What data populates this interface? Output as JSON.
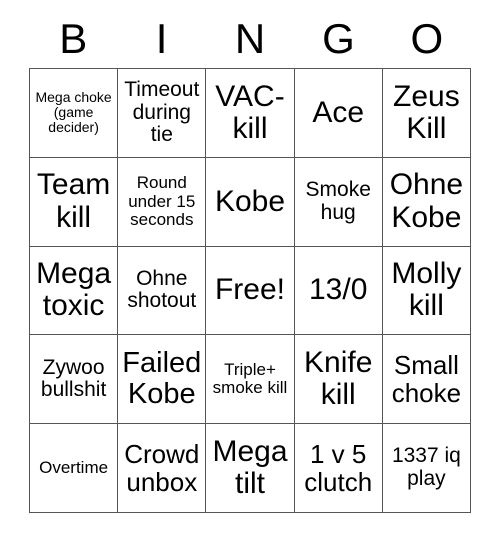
{
  "card": {
    "title": "BINGO",
    "header_letters": [
      "B",
      "I",
      "N",
      "G",
      "O"
    ],
    "rows": 5,
    "columns": 5,
    "grid_line_color": "#555555",
    "background_color": "#ffffff",
    "text_color": "#000000",
    "free_space": "Free!",
    "free_space_position": {
      "row": 3,
      "column": 3
    }
  },
  "cells": [
    {
      "id": "b1",
      "column": "B",
      "row": 1,
      "text": "Mega choke (game decider)",
      "size": "xs"
    },
    {
      "id": "i1",
      "column": "I",
      "row": 1,
      "text": "Timeout during tie",
      "size": "md"
    },
    {
      "id": "n1",
      "column": "N",
      "row": 1,
      "text": "VAC-kill",
      "size": "xl"
    },
    {
      "id": "g1",
      "column": "G",
      "row": 1,
      "text": "Ace",
      "size": "xl"
    },
    {
      "id": "o1",
      "column": "O",
      "row": 1,
      "text": "Zeus Kill",
      "size": "xl"
    },
    {
      "id": "b2",
      "column": "B",
      "row": 2,
      "text": "Team kill",
      "size": "xl"
    },
    {
      "id": "i2",
      "column": "I",
      "row": 2,
      "text": "Round under 15 seconds",
      "size": "sm"
    },
    {
      "id": "n2",
      "column": "N",
      "row": 2,
      "text": "Kobe",
      "size": "xl"
    },
    {
      "id": "g2",
      "column": "G",
      "row": 2,
      "text": "Smoke hug",
      "size": "md"
    },
    {
      "id": "o2",
      "column": "O",
      "row": 2,
      "text": "Ohne Kobe",
      "size": "xl"
    },
    {
      "id": "b3",
      "column": "B",
      "row": 3,
      "text": "Mega toxic",
      "size": "xl"
    },
    {
      "id": "i3",
      "column": "I",
      "row": 3,
      "text": "Ohne shotout",
      "size": "md"
    },
    {
      "id": "n3",
      "column": "N",
      "row": 3,
      "text": "Free!",
      "size": "xl"
    },
    {
      "id": "g3",
      "column": "G",
      "row": 3,
      "text": "13/0",
      "size": "xl"
    },
    {
      "id": "o3",
      "column": "O",
      "row": 3,
      "text": "Molly kill",
      "size": "xl"
    },
    {
      "id": "b4",
      "column": "B",
      "row": 4,
      "text": "Zywoo bullshit",
      "size": "md"
    },
    {
      "id": "i4",
      "column": "I",
      "row": 4,
      "text": "Failed Kobe",
      "size": "xl"
    },
    {
      "id": "n4",
      "column": "N",
      "row": 4,
      "text": "Triple+ smoke kill",
      "size": "sm"
    },
    {
      "id": "g4",
      "column": "G",
      "row": 4,
      "text": "Knife kill",
      "size": "xl"
    },
    {
      "id": "o4",
      "column": "O",
      "row": 4,
      "text": "Small choke",
      "size": "lg"
    },
    {
      "id": "b5",
      "column": "B",
      "row": 5,
      "text": "Overtime",
      "size": "sm"
    },
    {
      "id": "i5",
      "column": "I",
      "row": 5,
      "text": "Crowd unbox",
      "size": "lg"
    },
    {
      "id": "n5",
      "column": "N",
      "row": 5,
      "text": "Mega tilt",
      "size": "xl"
    },
    {
      "id": "g5",
      "column": "G",
      "row": 5,
      "text": "1 v 5 clutch",
      "size": "lg"
    },
    {
      "id": "o5",
      "column": "O",
      "row": 5,
      "text": "1337 iq play",
      "size": "md"
    }
  ]
}
